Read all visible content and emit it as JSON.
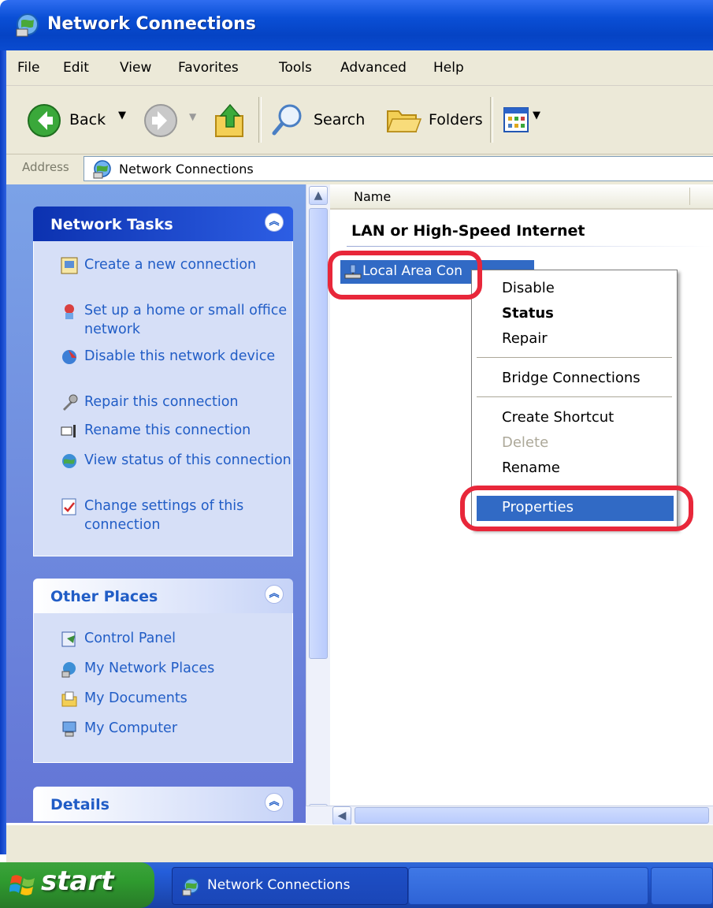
{
  "window": {
    "title": "Network Connections"
  },
  "menu": {
    "items": [
      "File",
      "Edit",
      "View",
      "Favorites",
      "Tools",
      "Advanced",
      "Help"
    ]
  },
  "toolbar": {
    "back_label": "Back",
    "search_label": "Search",
    "folders_label": "Folders"
  },
  "address": {
    "label": "Address",
    "value": "Network Connections"
  },
  "network_tasks": {
    "heading": "Network Tasks",
    "items": [
      {
        "label": "Create a new connection",
        "icon": "new-connection-icon"
      },
      {
        "label": "Set up a home or small office network",
        "icon": "home-network-icon"
      },
      {
        "label": "Disable this network device",
        "icon": "disable-device-icon"
      },
      {
        "label": "Repair this connection",
        "icon": "repair-icon"
      },
      {
        "label": "Rename this connection",
        "icon": "rename-icon"
      },
      {
        "label": "View status of this connection",
        "icon": "status-icon"
      },
      {
        "label": "Change settings of this connection",
        "icon": "settings-icon"
      }
    ]
  },
  "other_places": {
    "heading": "Other Places",
    "items": [
      {
        "label": "Control Panel",
        "icon": "control-panel-icon"
      },
      {
        "label": "My Network Places",
        "icon": "network-places-icon"
      },
      {
        "label": "My Documents",
        "icon": "documents-icon"
      },
      {
        "label": "My Computer",
        "icon": "computer-icon"
      }
    ]
  },
  "details": {
    "heading": "Details"
  },
  "content": {
    "column_name": "Name",
    "group_heading": "LAN or High-Speed Internet",
    "selected_item": "Local Area Con"
  },
  "context_menu": {
    "items": [
      "Disable",
      "Status",
      "Repair",
      "Bridge Connections",
      "Create Shortcut",
      "Delete",
      "Rename",
      "Properties"
    ],
    "disabled": [
      "Delete"
    ],
    "bold": [
      "Status"
    ],
    "highlighted": "Properties"
  },
  "taskbar": {
    "start_label": "start",
    "task_button": "Network Connections"
  },
  "colors": {
    "titlebar": "#0a4fd6",
    "selection": "#316ac5",
    "highlight_ring": "#e8273a",
    "task_link": "#215dc6"
  }
}
